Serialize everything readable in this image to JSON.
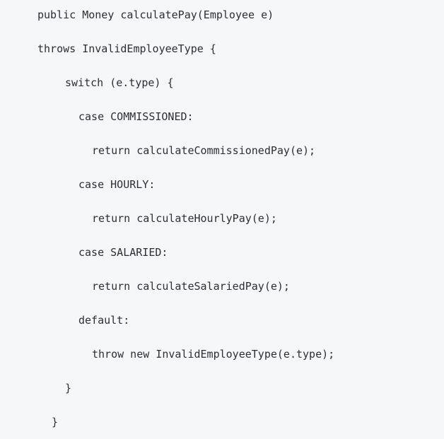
{
  "code": {
    "lines": [
      "public Money calculatePay(Employee e)",
      "throws InvalidEmployeeType {",
      "switch (e.type) {",
      "case COMMISSIONED:",
      "return calculateCommissionedPay(e);",
      "case HOURLY:",
      "return calculateHourlyPay(e);",
      "case SALARIED:",
      "return calculateSalariedPay(e);",
      "default:",
      "throw new InvalidEmployeeType(e.type);",
      "}",
      "}"
    ]
  }
}
